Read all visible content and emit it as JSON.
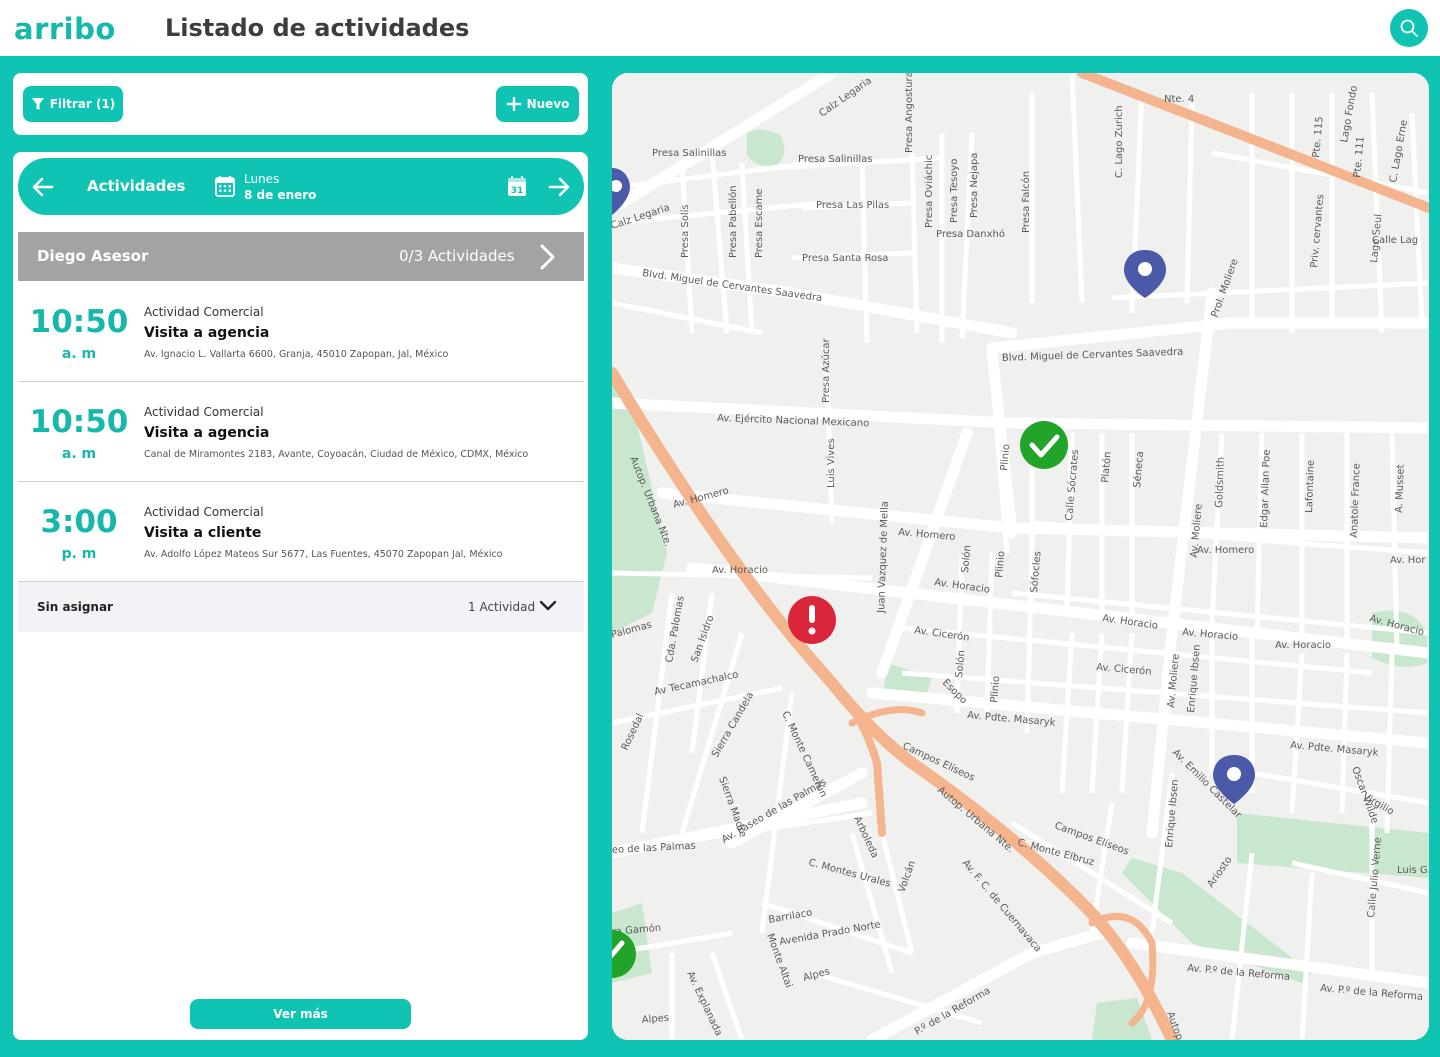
{
  "header": {
    "logo": "arribo",
    "title": "Listado de actividades"
  },
  "toolbar": {
    "filter_label": "Filtrar (1)",
    "new_label": "Nuevo"
  },
  "date_nav": {
    "title": "Actividades",
    "day": "Lunes",
    "date": "8 de enero",
    "calendar_day": "31"
  },
  "advisor": {
    "name": "Diego Asesor",
    "count": "0/3 Actividades"
  },
  "activities": [
    {
      "time": "10:50",
      "ampm": "a. m",
      "type": "Actividad Comercial",
      "title": "Visita a agencia",
      "address": "Av. Ignacio L. Vallarta 6600, Granja, 45010 Zapopan, Jal, México"
    },
    {
      "time": "10:50",
      "ampm": "a. m",
      "type": "Actividad Comercial",
      "title": "Visita a agencia",
      "address": "Canal de Miramontes 2183, Avante, Coyoacán, Ciudad de México, CDMX, México"
    },
    {
      "time": "3:00",
      "ampm": "p. m",
      "type": "Actividad Comercial",
      "title": "Visita a cliente",
      "address": "Av. Adolfo López Mateos Sur 5677, Las Fuentes, 45070 Zapopan Jal, México"
    }
  ],
  "unassigned": {
    "label": "Sin asignar",
    "count": "1 Actividad"
  },
  "more_label": "Ver más",
  "colors": {
    "accent": "#0fc4b2",
    "pin_blue": "#4a5aa8",
    "pin_green": "#22a32a",
    "pin_red": "#d9263a",
    "highway": "#f3b48e"
  },
  "map": {
    "labels": {
      "nte4": "Nte. 4",
      "calz_legaria": "Calz Legaria",
      "calz_legaria2": "Calz Legaria",
      "presa_salinillas": "Presa Salinillas",
      "presa_salinillas2": "Presa Salinillas",
      "presa_angostura": "Presa Angostura",
      "presa_las_pilas": "Presa Las Pilas",
      "presa_danxho": "Presa Danxhó",
      "presa_santa_rosa": "Presa Santa Rosa",
      "presa_falcon": "Presa Falcón",
      "presa_solis": "Presa Solís",
      "presa_pabellon": "Presa Pabellón",
      "presa_escame": "Presa Escame",
      "presa_ovilachic": "Presa Oviáchic",
      "presa_tesoyo": "Presa Tesoyo",
      "presa_nejapa": "Presa Nejapa",
      "lago_zurich": "C. Lago Zurich",
      "blvd_cervantes": "Blvd. Miguel de Cervantes Saavedra",
      "blvd_cervantes2": "Blvd. Miguel de Cervantes Saavedra",
      "prol_moliere": "Prol. Moliere",
      "av_ejercito": "Av. Ejército Nacional Mexicano",
      "presa_azucar": "Presa Azúcar",
      "luis_vives": "Luis Vives",
      "autop_urbana": "Autop. Urbana Nte.",
      "autop_urbana2": "Autop. Urbana Nte.",
      "av_homero": "Av. Homero",
      "av_homero2": "Av. Homero",
      "av_homero3": "Av. Homero",
      "av_hor": "Av. Hor",
      "juan_vazquez": "Juan Vazquez de Mella",
      "av_horacio": "Av. Horacio",
      "av_horacio2": "Av. Horacio",
      "av_horacio3": "Av. Horacio",
      "av_horacio4": "Av. Horacio",
      "av_horacio5": "Av. Horacio",
      "av_horacio6": "Av. Horacio",
      "av_ciceron": "Av. Cicerón",
      "av_ciceron2": "Av. Cicerón",
      "av_moliere": "Av. Moliere",
      "av_moliere2": "Av. Moliere",
      "av_pdte_masaryk": "Av. Pdte. Masaryk",
      "av_pdte_masaryk2": "Av. Pdte. Masaryk",
      "platon": "Platón",
      "seneca": "Séneca",
      "socrates": "Calle Sócrates",
      "goldsmith": "Goldsmith",
      "edgar_poe": "Edgar Allan Poe",
      "lafontaine": "Lafontaine",
      "anatole": "Anatole France",
      "musset": "A. Musset",
      "av_tecamachalco": "Av Tecamachalco",
      "av_paseo_palmas": "Av. Paseo de las Palmas",
      "eo_palmas": "eo de las Palmas",
      "campos_eliseos": "Campos Elíseos",
      "campos_eliseos2": "Campos Elíseos",
      "monte_elbruz": "C. Monte Elbruz",
      "montes_urales": "C. Montes Urales",
      "av_reforma": "Av. P.º de la Reforma",
      "av_reforma2": "Av. P.º de la Reforma",
      "p_reforma": "P.º de la Reforma",
      "prado_norte": "Avenida Prado Norte",
      "barrilaco": "Barrilaco",
      "alpes": "Alpes",
      "alpes2": "Alpes",
      "sierra_candela": "Sierra Candela",
      "sierra_madre": "Sierra Madre",
      "monte_cameron": "C. Monte Camerún",
      "volcan": "Volcán",
      "arboleda": "Arboleda",
      "rosedal": "Rosedal",
      "san_isidro": "San Isidro",
      "palomas": "Palomas",
      "cda_palomas": "Cda. Palomas",
      "ra_gamon": "ra Gamón",
      "av_explanada": "Av. Explanada",
      "monte_altai": "Monte Altai",
      "virgilio": "Virgilio",
      "oscar_wilde": "Oscar Wilde",
      "luis_g": "Luis G. U",
      "calle_julio_verne": "Calle Julio Verne",
      "fc_cuernavaca": "Av. F. C. de Cuernavaca",
      "emilio_castelar": "Av. Emilio Castelar",
      "ariosto": "Ariosto",
      "enrique_ibsen": "Enrique Ibsen",
      "enrique_ibsen2": "Enrique Ibsen",
      "pte_115": "Pte. 115",
      "pte_111": "Pte. 111",
      "lago_fondo": "Lago Fondo",
      "c_lago_erne": "C. Lago Erne",
      "calle_lago": "Calle Lag",
      "lago_seul": "Lago Seul",
      "priv_cervantes": "Priv. cervantes",
      "solon": "Solón",
      "solon2": "Solón",
      "plinio": "Plinio",
      "plinio2": "Plinio",
      "plinio3": "Plinio",
      "sofocles": "Sófocles",
      "esopo": "Esopo",
      "autop": "Autop."
    }
  }
}
